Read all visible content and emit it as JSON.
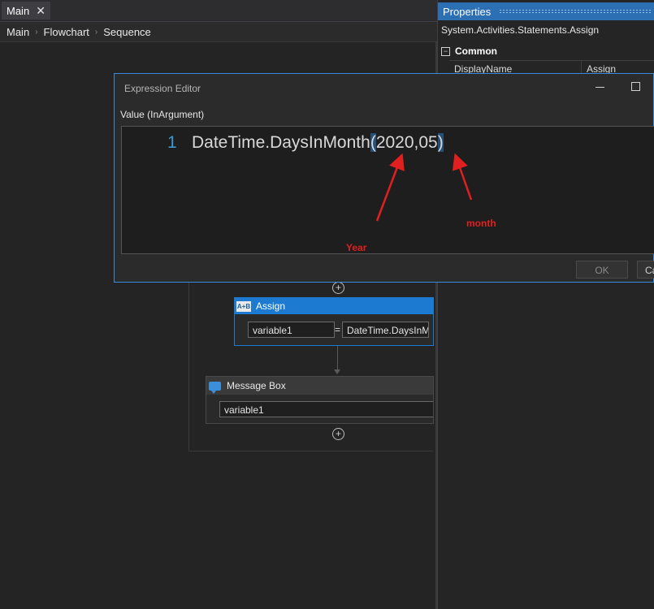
{
  "tabs": {
    "main_label": "Main",
    "close_glyph": "✕"
  },
  "breadcrumb": {
    "items": [
      "Main",
      "Flowchart",
      "Sequence"
    ],
    "separator": "›"
  },
  "workflow": {
    "assign": {
      "title": "Assign",
      "icon_text": "A+B",
      "to_value": "variable1",
      "equals": "=",
      "value_text": "DateTime.DaysInM"
    },
    "message_box": {
      "title": "Message Box",
      "text_value": "variable1"
    },
    "add_glyph": "+"
  },
  "properties": {
    "title": "Properties",
    "type_name": "System.Activities.Statements.Assign",
    "category": "Common",
    "rows": [
      {
        "name": "DisplayName",
        "value": "Assign"
      }
    ]
  },
  "expression_editor": {
    "title": "Expression Editor",
    "field_label": "Value (InArgument)",
    "line_number": "1",
    "code_prefix": "DateTime.DaysInMonth",
    "code_open_paren": "(",
    "code_args": "2020,05",
    "code_close_paren": ")",
    "ok_label": "OK",
    "cancel_label": "Ca"
  },
  "annotations": {
    "year_label": "Year",
    "month_label": "month",
    "color": "#e02020"
  }
}
